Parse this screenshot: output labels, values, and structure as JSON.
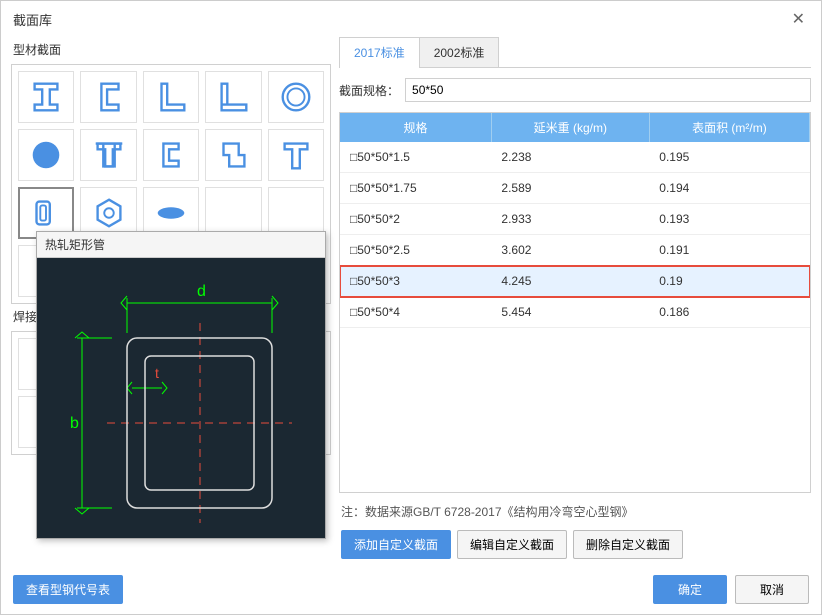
{
  "dialog": {
    "title": "截面库"
  },
  "left": {
    "section1_label": "型材截面",
    "section2_label": "焊接截",
    "view_code_table_btn": "查看型钢代号表"
  },
  "tooltip": {
    "title": "热轧矩形管",
    "label_d": "d",
    "label_b": "b",
    "label_t": "t"
  },
  "tabs": {
    "t2017": "2017标准",
    "t2002": "2002标准"
  },
  "filter": {
    "label": "截面规格：",
    "value": "50*50"
  },
  "table": {
    "headers": {
      "spec": "规格",
      "weight": "延米重 (kg/m)",
      "area": "表面积 (m²/m)"
    },
    "rows": [
      {
        "spec": "□50*50*1.5",
        "weight": "2.238",
        "area": "0.195"
      },
      {
        "spec": "□50*50*1.75",
        "weight": "2.589",
        "area": "0.194"
      },
      {
        "spec": "□50*50*2",
        "weight": "2.933",
        "area": "0.193"
      },
      {
        "spec": "□50*50*2.5",
        "weight": "3.602",
        "area": "0.191"
      },
      {
        "spec": "□50*50*3",
        "weight": "4.245",
        "area": "0.19"
      },
      {
        "spec": "□50*50*4",
        "weight": "5.454",
        "area": "0.186"
      }
    ]
  },
  "note": "注：数据来源GB/T 6728-2017《结构用冷弯空心型钢》",
  "buttons": {
    "add_custom": "添加自定义截面",
    "edit_custom": "编辑自定义截面",
    "delete_custom": "删除自定义截面",
    "ok": "确定",
    "cancel": "取消"
  }
}
